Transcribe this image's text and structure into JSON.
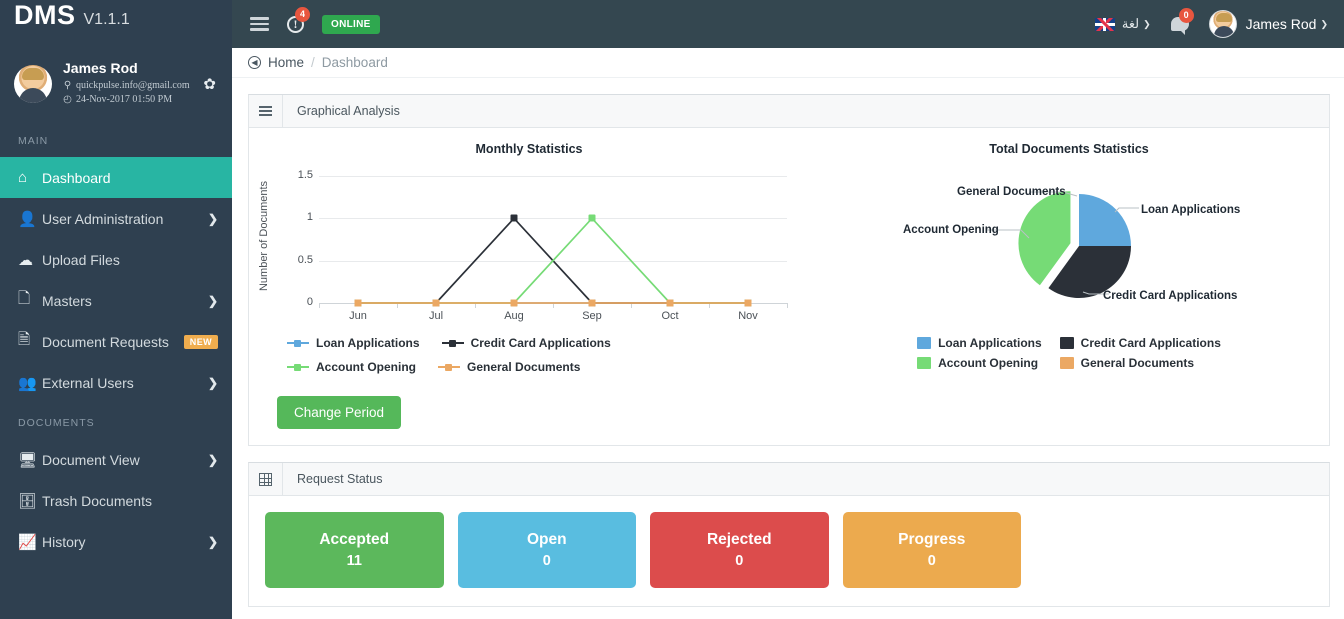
{
  "topbar": {
    "logo": "DMS",
    "version": "V1.1.1",
    "menu_icon": "hamburger-icon",
    "alert_badge": "4",
    "online_label": "ONLINE",
    "language_label": "لغة",
    "chat_badge": "0",
    "user_name": "James Rod",
    "caret": "❯"
  },
  "profile": {
    "name": "James Rod",
    "email": "quickpulse.info@gmail.com",
    "datetime": "24-Nov-2017 01:50 PM",
    "email_icon": "location-pin-icon",
    "time_icon": "clock-icon",
    "settings_icon": "gear-icon"
  },
  "sidebar": {
    "sections": [
      {
        "heading": "MAIN",
        "items": [
          {
            "label": "Dashboard",
            "icon": "home-icon",
            "active": true,
            "arrow": "",
            "badge": ""
          },
          {
            "label": "User Administration",
            "icon": "user-icon",
            "active": false,
            "arrow": "❯",
            "badge": ""
          },
          {
            "label": "Upload Files",
            "icon": "upload-cloud-icon",
            "active": false,
            "arrow": "",
            "badge": ""
          },
          {
            "label": "Masters",
            "icon": "file-icon",
            "active": false,
            "arrow": "❯",
            "badge": ""
          },
          {
            "label": "Document Requests",
            "icon": "export-file-icon",
            "active": false,
            "arrow": "",
            "badge": "NEW"
          },
          {
            "label": "External Users",
            "icon": "external-user-icon",
            "active": false,
            "arrow": "❯",
            "badge": ""
          }
        ]
      },
      {
        "heading": "DOCUMENTS",
        "items": [
          {
            "label": "Document View",
            "icon": "monitor-icon",
            "active": false,
            "arrow": "❯",
            "badge": ""
          },
          {
            "label": "Trash Documents",
            "icon": "database-icon",
            "active": false,
            "arrow": "",
            "badge": ""
          },
          {
            "label": "History",
            "icon": "area-chart-icon",
            "active": false,
            "arrow": "❯",
            "badge": ""
          }
        ]
      }
    ]
  },
  "breadcrumb": {
    "back_icon": "circle-arrow-left-icon",
    "home": "Home",
    "separator": "/",
    "current": "Dashboard"
  },
  "panels": {
    "graphical_analysis": {
      "title": "Graphical Analysis",
      "icon": "hamburger-icon"
    },
    "request_status": {
      "title": "Request Status",
      "icon": "grid-icon"
    }
  },
  "buttons": {
    "change_period": "Change Period"
  },
  "colors": {
    "loan": "#5fa8dd",
    "credit_card": "#2b3038",
    "account_opening": "#76db76",
    "general_documents": "#eba863",
    "accepted": "#5cb85c",
    "open": "#59bde0",
    "rejected": "#dc4c4c",
    "progress": "#ecaa4e",
    "active_nav": "#28b5a3",
    "change_period": "#55b85a"
  },
  "chart_data": [
    {
      "type": "line",
      "title": "Monthly Statistics",
      "xlabel": "",
      "ylabel": "Number of Documents",
      "categories": [
        "Jun",
        "Jul",
        "Aug",
        "Sep",
        "Oct",
        "Nov"
      ],
      "ylim": [
        0,
        1.5
      ],
      "yticks": [
        "0",
        "0.5",
        "1",
        "1.5"
      ],
      "grid": true,
      "legend_position": "bottom",
      "series": [
        {
          "name": "Loan Applications",
          "color": "#5fa8dd",
          "values": [
            0,
            0,
            0,
            0,
            0,
            0
          ]
        },
        {
          "name": "Credit Card Applications",
          "color": "#2b3038",
          "values": [
            0,
            0,
            1,
            0,
            0,
            0
          ]
        },
        {
          "name": "Account Opening",
          "color": "#76db76",
          "values": [
            0,
            0,
            0,
            1,
            0,
            0
          ]
        },
        {
          "name": "General Documents",
          "color": "#eba863",
          "values": [
            0,
            0,
            0,
            0,
            0,
            0
          ]
        }
      ]
    },
    {
      "type": "pie",
      "title": "Total Documents Statistics",
      "legend_position": "bottom",
      "labels": [
        "Loan Applications",
        "Credit Card Applications",
        "Account Opening",
        "General Documents"
      ],
      "values": [
        25,
        35,
        40,
        0
      ],
      "colors": [
        "#5fa8dd",
        "#2b3038",
        "#76db76",
        "#eba863"
      ],
      "callouts": [
        {
          "label": "General Documents"
        },
        {
          "label": "Loan Applications"
        },
        {
          "label": "Account Opening"
        },
        {
          "label": "Credit Card Applications"
        }
      ]
    }
  ],
  "status_cards": [
    {
      "label": "Accepted",
      "value": "11",
      "color": "#5cb85c"
    },
    {
      "label": "Open",
      "value": "0",
      "color": "#59bde0"
    },
    {
      "label": "Rejected",
      "value": "0",
      "color": "#dc4c4c"
    },
    {
      "label": "Progress",
      "value": "0",
      "color": "#ecaa4e"
    }
  ]
}
